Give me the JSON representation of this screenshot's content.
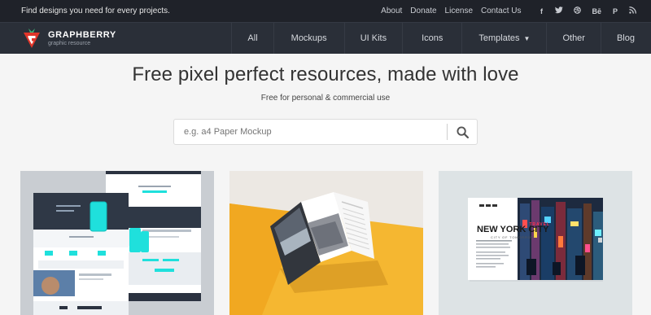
{
  "topbar": {
    "tagline": "Find designs you need for every projects.",
    "links": [
      "About",
      "Donate",
      "License",
      "Contact Us"
    ],
    "social_icons": [
      "facebook-icon",
      "twitter-icon",
      "dribbble-icon",
      "behance-icon",
      "pinterest-icon",
      "rss-icon"
    ]
  },
  "brand": {
    "name": "GRAPHBERRY",
    "subtitle": "graphic resource",
    "accent": "#e0362a"
  },
  "nav": {
    "items": [
      "All",
      "Mockups",
      "UI Kits",
      "Icons",
      "Templates",
      "Other",
      "Blog"
    ]
  },
  "hero": {
    "title": "Free pixel perfect resources, made with love",
    "subtitle": "Free for personal & commercial use"
  },
  "search": {
    "placeholder": "e.g. a4 Paper Mockup"
  },
  "cards": {
    "card3": {
      "small_label": "TRAVEL",
      "headline": "NEW YORK CITY",
      "tagline": "CITY OF TOMORROW"
    }
  },
  "colors": {
    "topbar": "#1f2229",
    "navbar": "#2a2f38",
    "page": "#f5f5f5",
    "cyan": "#1fe0dc",
    "yellow": "#f5b731"
  }
}
